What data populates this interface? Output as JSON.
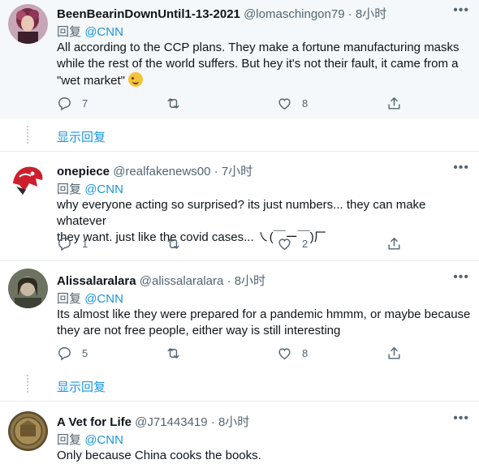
{
  "tweets": [
    {
      "name": "BeenBearinDownUntil1-13-2021",
      "handle": "@lomaschingon79",
      "time": "· 8小时",
      "reply_prefix": "回复",
      "reply_to": "@CNN",
      "text_lines": [
        "All according to the CCP plans.  They make a fortune manufacturing masks",
        "while the rest of the world suffers.  But hey it's not their fault, it came from a",
        "\"wet market\""
      ],
      "emoji": "winking-face-emoji",
      "replies": "7",
      "retweets": "",
      "likes": "8",
      "show_replies": "显示回复"
    },
    {
      "name": "onepiece",
      "handle": "@realfakenews00",
      "time": "· 7小时",
      "reply_prefix": "回复",
      "reply_to": "@CNN",
      "text_lines": [
        "why everyone acting so surprised? its just numbers... they can make whatever",
        "they want.  just like the covid cases... ㇏(￣ー￣)厂"
      ],
      "replies": "1",
      "retweets": "",
      "likes": "2"
    },
    {
      "name": "Alissalaralara",
      "handle": "@alissalaralara",
      "time": "· 8小时",
      "reply_prefix": "回复",
      "reply_to": "@CNN",
      "text_lines": [
        "Its almost like they were prepared for a pandemic hmmm, or maybe because",
        "they are not free people, either way is still interesting"
      ],
      "replies": "5",
      "retweets": "",
      "likes": "8",
      "show_replies": "显示回复"
    },
    {
      "name": "A Vet for Life",
      "handle": "@J71443419",
      "time": "· 8小时",
      "reply_prefix": "回复",
      "reply_to": "@CNN",
      "text_lines": [
        "Only because China cooks the books."
      ]
    }
  ],
  "colors": {
    "accent": "#1b95e0",
    "muted": "#536471",
    "text": "#0f1419",
    "divider": "#e6ecf0",
    "highlight_bg": "#f5f8fa"
  }
}
